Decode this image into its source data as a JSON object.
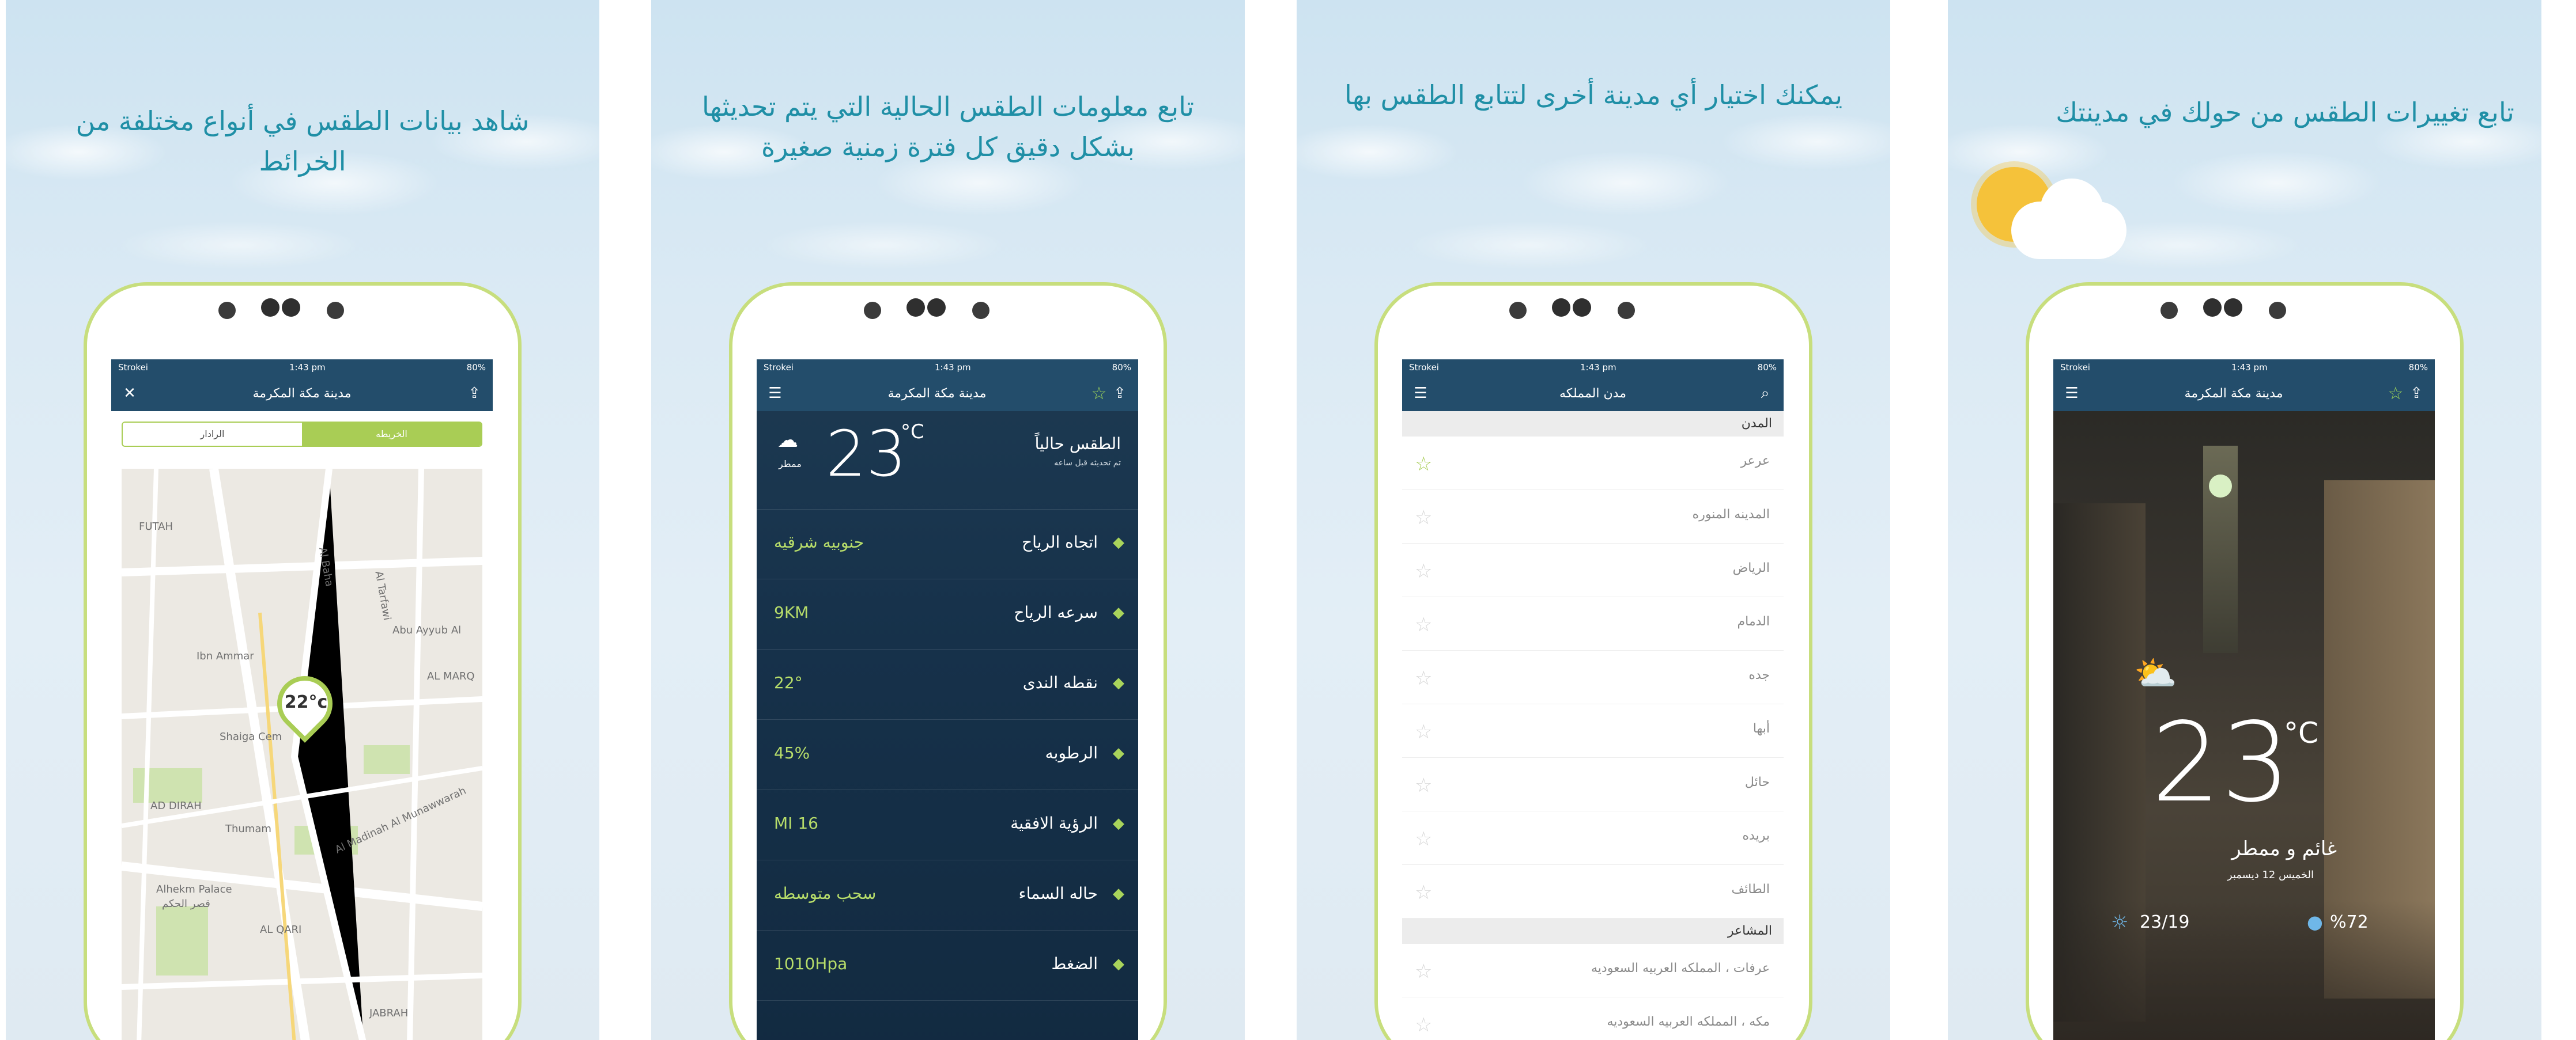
{
  "panels": [
    {
      "caption": "شاهد بيانات الطقس في أنواع مختلفة من الخرائط",
      "status": {
        "carrier": "Strokei",
        "time": "1:43 pm",
        "battery": "80%"
      },
      "nav": {
        "title": "مدينة مكة المكرمة",
        "close_icon": "close-icon",
        "share_icon": "share-icon"
      },
      "segments": {
        "left": "الخريطه",
        "right": "الرادار"
      },
      "map": {
        "pin_temp": "22°c",
        "labels": [
          "FUTAH",
          "Abu Ayyub Al",
          "Ibn Ammar",
          "AL MARQ",
          "Shaiga Cem",
          "AD DIRAH",
          "Thumam",
          "Al Madinah Al Munawwarah",
          "Alhekm Palace",
          "قصر الحكم",
          "AL QARI",
          "JABRAH",
          "Al Baha",
          "Al Tarfawi"
        ]
      }
    },
    {
      "caption": "تابع معلومات الطقس الحالية التي يتم تحديثها بشكل دقيق كل فترة زمنية صغيرة",
      "status": {
        "carrier": "Strokei",
        "time": "1:43 pm",
        "battery": "80%"
      },
      "nav": {
        "title": "مدينة مكة المكرمة"
      },
      "current": {
        "label": "الطقس حالياً",
        "sub": "تم تحديثه قبل ساعه",
        "temp": "23",
        "unit": "°C",
        "condition": "ممطر"
      },
      "rows": [
        {
          "label": "اتجاه الرياح",
          "value": "جنوبيه شرقيه",
          "icon": "wind-flag-icon"
        },
        {
          "label": "سرعه الرياح",
          "value": "9KM",
          "icon": "wind-turbine-icon"
        },
        {
          "label": "نقطه الندى",
          "value": "22°",
          "icon": "drop-icon"
        },
        {
          "label": "الرطوبه",
          "value": "45%",
          "icon": "humidity-icon"
        },
        {
          "label": "الرؤية الافقية",
          "value": "16 MI",
          "icon": "eye-icon"
        },
        {
          "label": "حاله السماء",
          "value": "سحب متوسطه",
          "icon": "cloud-icon"
        },
        {
          "label": "الضغط",
          "value": "1010Hpa",
          "icon": "gauge-icon"
        }
      ],
      "dots": "● ● ● ●"
    },
    {
      "caption": "يمكنك اختيار أي مدينة أخرى لتتابع الطقس بها",
      "status": {
        "carrier": "Strokei",
        "time": "1:43 pm",
        "battery": "80%"
      },
      "nav": {
        "title": "مدن المملكه"
      },
      "sections": [
        {
          "header": "المدن",
          "items": [
            "عرعر",
            "المدينه المنوره",
            "الرياض",
            "الدمام",
            "جده",
            "أبها",
            "حائل",
            "بريده",
            "الطائف"
          ]
        },
        {
          "header": "المشاعر",
          "items": [
            "عرفات ، المملكه العربيه السعوديه",
            "مكه ، المملكه العربيه السعوديه"
          ]
        }
      ]
    },
    {
      "caption": "تابع تغييرات الطقس من حولك في مدينتك",
      "status": {
        "carrier": "Strokei",
        "time": "1:43 pm",
        "battery": "80%"
      },
      "nav": {
        "title": "مدينة مكة المكرمة"
      },
      "weather": {
        "temp": "23",
        "unit": "°C",
        "condition": "غائم و ممطر",
        "date": "الخميس 12 ديسمبر",
        "range": "23/19",
        "humidity": "%72"
      },
      "dots": "● ● ● ●"
    }
  ]
}
